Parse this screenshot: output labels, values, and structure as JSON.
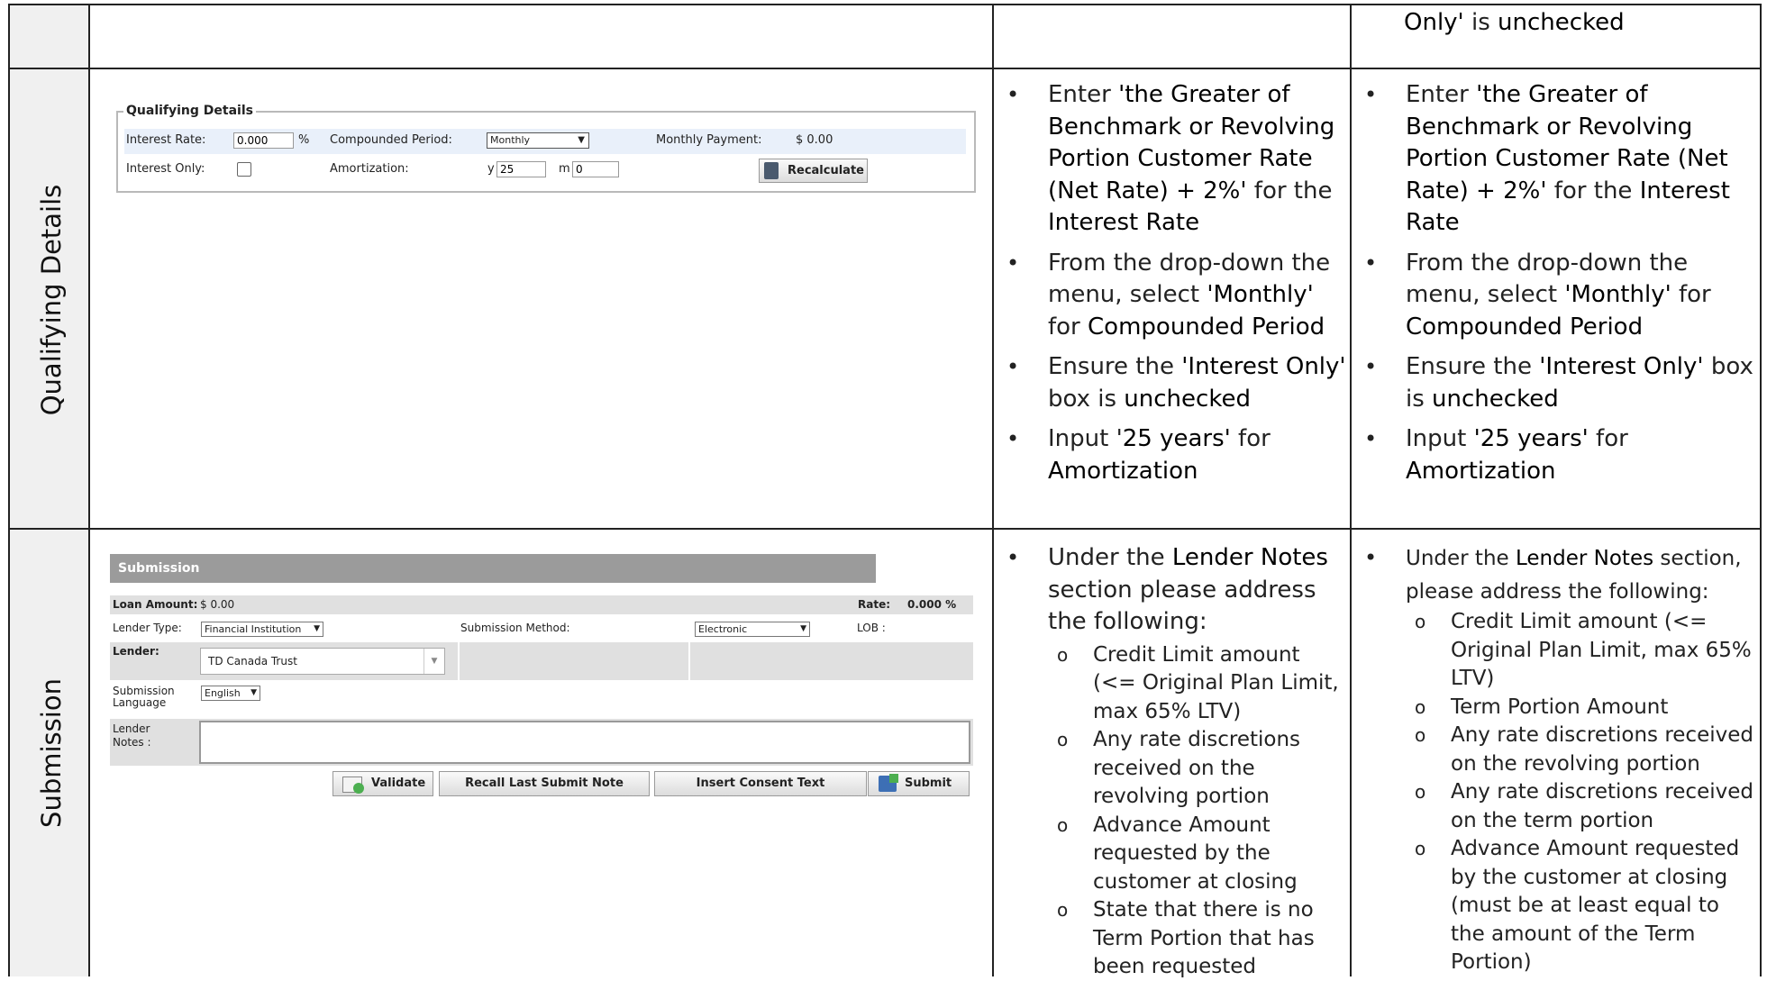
{
  "rows": {
    "top": {
      "right_line1_bold": "Only'",
      "right_line1_mid": " is ",
      "right_line1_end": "unchecked"
    },
    "qualifying": {
      "side_label": "Qualifying Details",
      "widget": {
        "legend": "Qualifying Details",
        "interest_rate_label": "Interest Rate:",
        "interest_rate_value": "0.000",
        "percent": "%",
        "compounded_label": "Compounded Period:",
        "compounded_value": "Monthly",
        "monthly_payment_label": "Monthly Payment:",
        "monthly_payment_value": "$ 0.00",
        "interest_only_label": "Interest Only:",
        "amortization_label": "Amortization:",
        "y_label": "y",
        "years_value": "25",
        "m_label": "m",
        "months_value": "0",
        "recalc_label": "Recalculate"
      },
      "col3": [
        {
          "a": "Enter ",
          "b": "'the Greater of Benchmark or Revolving Portion Customer Rate (Net Rate) + 2%'",
          "c": " for the ",
          "d": "Interest Rate"
        },
        {
          "a": "From the drop-down the menu, select ",
          "b": "'Monthly'",
          "c": " for ",
          "d": "Compounded Period"
        },
        {
          "a": "Ensure the ",
          "b": "'Interest Only'",
          "c": " box is ",
          "d": "unchecked"
        },
        {
          "a": "Input '",
          "b": "25 years'",
          "c": " for ",
          "d": "Amortization"
        }
      ],
      "col4": [
        {
          "a": "Enter ",
          "b": "'the Greater of Benchmark or Revolving Portion Customer Rate (Net Rate) + 2%'",
          "c": " for the ",
          "d": "Interest Rate"
        },
        {
          "a": "From the drop-down the menu, select ",
          "b": "'Monthly'",
          "c": " for ",
          "d": "Compounded Period"
        },
        {
          "a": "Ensure the ",
          "b": "'Interest Only'",
          "c": " box is ",
          "d": "unchecked"
        },
        {
          "a": "Input ",
          "b": "'25 years'",
          "c": " for ",
          "d": "Amortization"
        }
      ]
    },
    "submission": {
      "side_label": "Submission",
      "widget": {
        "header": "Submission",
        "loan_amount_label": "Loan Amount:",
        "loan_amount_value": "$ 0.00",
        "rate_label": "Rate:",
        "rate_value": "0.000 %",
        "lender_type_label": "Lender Type:",
        "lender_type_value": "Financial Institution",
        "submission_method_label": "Submission Method:",
        "submission_method_value": "Electronic",
        "lob_label": "LOB :",
        "lender_label": "Lender:",
        "lender_value": "TD Canada Trust",
        "submission_language_label": "Submission Language",
        "submission_language_value": "English",
        "lender_notes_label": "Lender Notes :",
        "validate_label": "Validate",
        "recall_label": "Recall Last Submit Note",
        "consent_label": "Insert Consent Text",
        "submit_label": "Submit"
      },
      "col3": {
        "intro_a": "Under the ",
        "intro_b": "Lender Notes",
        "intro_c": " section please address the following:",
        "items": [
          "Credit Limit amount (<= Original Plan Limit, max 65% LTV)",
          "Any rate discretions received on the revolving portion",
          "Advance Amount requested by the customer at closing",
          "State that there is no Term Portion that has been requested"
        ]
      },
      "col4": {
        "intro_a": "Under the ",
        "intro_b": "Lender Notes",
        "intro_c": " section, please address the following:",
        "items": [
          "Credit Limit amount (<= Original Plan Limit, max 65% LTV)",
          "Term Portion Amount",
          "Any rate discretions received on the revolving portion",
          "Any rate discretions received on the term portion",
          "Advance Amount requested by the customer at closing (must be at least equal to the amount of the Term Portion)"
        ]
      }
    }
  }
}
